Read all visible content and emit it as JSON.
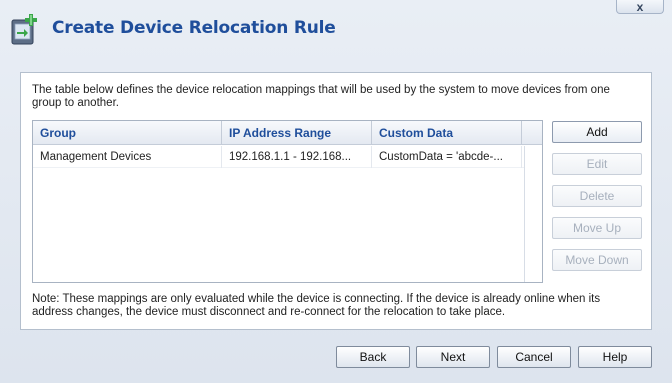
{
  "window": {
    "title": "Create Device Relocation Rule",
    "close_label": "x"
  },
  "intro_text": "The table below defines the device relocation mappings that will be used by the system to move devices from one group to another.",
  "table": {
    "columns": [
      "Group",
      "IP Address Range",
      "Custom Data"
    ],
    "rows": [
      [
        "Management Devices",
        "192.168.1.1 - 192.168...",
        "CustomData = 'abcde-..."
      ]
    ]
  },
  "side_buttons": {
    "add": "Add",
    "edit": "Edit",
    "delete": "Delete",
    "move_up": "Move Up",
    "move_down": "Move Down"
  },
  "note_text": "Note: These mappings are only evaluated while the device is connecting. If the device is already online when its address changes, the device must disconnect and re-connect for the relocation to take place.",
  "footer": {
    "back": "Back",
    "next": "Next",
    "cancel": "Cancel",
    "help": "Help"
  },
  "colors": {
    "title": "#1f4e9b",
    "header_text": "#1f4e9b",
    "icon_green": "#3aa64a"
  },
  "icons": {
    "app": "device-relocation-icon",
    "close": "close-icon"
  }
}
